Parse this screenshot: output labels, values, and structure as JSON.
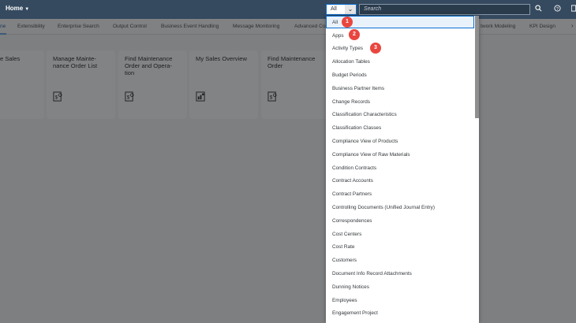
{
  "shell": {
    "home": "Home",
    "scope_value": "All",
    "search_placeholder": "Search"
  },
  "tabs": [
    "ne",
    "Extensibility",
    "Enterprise Search",
    "Output Control",
    "Business Event Handling",
    "Message Monitoring",
    "Advanced Co",
    "twork Modeling",
    "KPI Design"
  ],
  "tiles": [
    {
      "title": "e Sales"
    },
    {
      "title": "Manage Mainte-\nnance Order List"
    },
    {
      "title": "Find Maintenance\nOrder and Opera-\ntion"
    },
    {
      "title": "My Sales Overview"
    },
    {
      "title": "Find Maintenance\nOrder"
    }
  ],
  "dropdown_items": [
    "All",
    "Apps",
    "Activity Types",
    "Allocation Tables",
    "Budget Periods",
    "Business Partner Items",
    "Change Records",
    "Classification Characteristics",
    "Classification Classes",
    "Compliance View of Products",
    "Compliance View of Raw Materials",
    "Condition Contracts",
    "Contract Accounts",
    "Contract Partners",
    "Controlling Documents (Unified Journal Entry)",
    "Correspondences",
    "Cost Centers",
    "Cost Rate",
    "Customers",
    "Document Info Record Attachments",
    "Dunning Notices",
    "Employees",
    "Engagement Project"
  ],
  "badges": [
    "1",
    "2",
    "3"
  ],
  "colors": {
    "shell": "#354a5f",
    "accent": "#0a6ed1",
    "badge": "#e9463f"
  }
}
